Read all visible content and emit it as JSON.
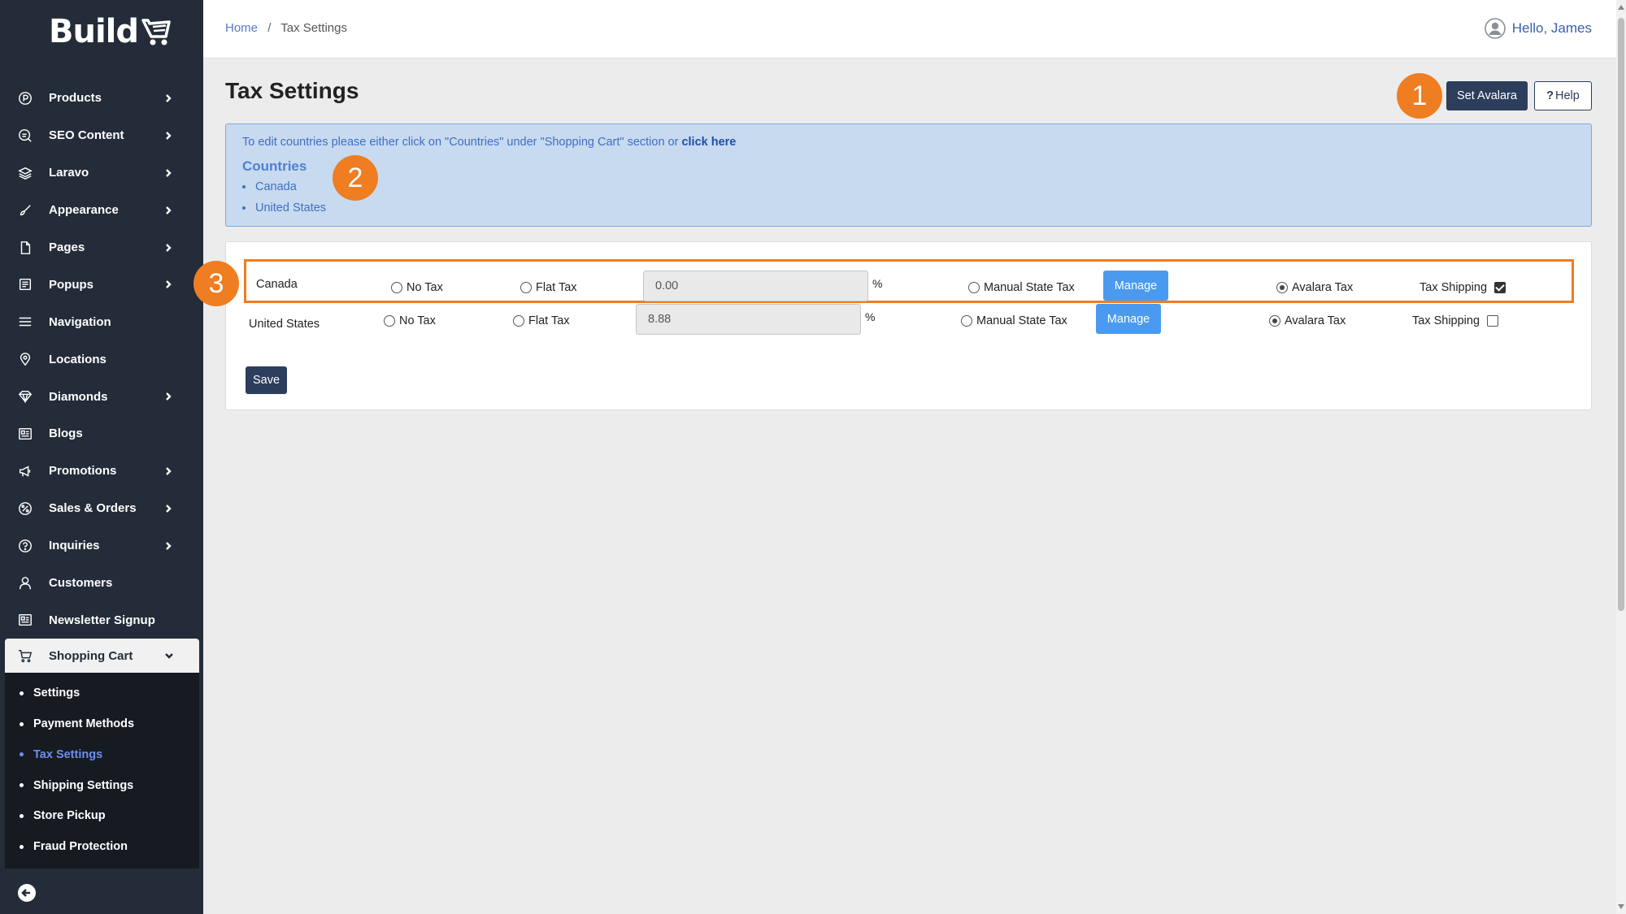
{
  "app": {
    "logo_text": "Build"
  },
  "sidebar": {
    "items": [
      {
        "label": "Products",
        "icon": "products-icon",
        "has_children": true
      },
      {
        "label": "SEO Content",
        "icon": "seo-icon",
        "has_children": true
      },
      {
        "label": "Laravo",
        "icon": "layers-icon",
        "has_children": true
      },
      {
        "label": "Appearance",
        "icon": "brush-icon",
        "has_children": true
      },
      {
        "label": "Pages",
        "icon": "file-icon",
        "has_children": true
      },
      {
        "label": "Popups",
        "icon": "popup-icon",
        "has_children": true
      },
      {
        "label": "Navigation",
        "icon": "menu-icon",
        "has_children": false
      },
      {
        "label": "Locations",
        "icon": "map-pin-icon",
        "has_children": false
      },
      {
        "label": "Diamonds",
        "icon": "diamond-icon",
        "has_children": true
      },
      {
        "label": "Blogs",
        "icon": "blog-icon",
        "has_children": false
      },
      {
        "label": "Promotions",
        "icon": "megaphone-icon",
        "has_children": true
      },
      {
        "label": "Sales & Orders",
        "icon": "percent-icon",
        "has_children": true
      },
      {
        "label": "Inquiries",
        "icon": "question-icon",
        "has_children": true
      },
      {
        "label": "Customers",
        "icon": "user-icon",
        "has_children": false
      },
      {
        "label": "Newsletter Signup",
        "icon": "newsletter-icon",
        "has_children": false
      },
      {
        "label": "Shopping Cart",
        "icon": "cart-icon",
        "has_children": true,
        "expanded": true
      }
    ],
    "sub_items": [
      {
        "label": "Settings"
      },
      {
        "label": "Payment Methods"
      },
      {
        "label": "Tax Settings",
        "current": true
      },
      {
        "label": "Shipping Settings"
      },
      {
        "label": "Store Pickup"
      },
      {
        "label": "Fraud Protection"
      }
    ]
  },
  "header": {
    "breadcrumb": {
      "home": "Home",
      "separator": "/",
      "current": "Tax Settings"
    },
    "user_greeting": "Hello, James"
  },
  "page": {
    "title": "Tax Settings",
    "set_avalara_label": "Set Avalara",
    "help_label": "Help",
    "help_prefix": "?"
  },
  "markers": {
    "m1": "1",
    "m2": "2",
    "m3": "3"
  },
  "info": {
    "message": "To edit countries please either click on \"Countries\" under \"Shopping Cart\" section or ",
    "link_text": "click here",
    "countries_title": "Countries",
    "countries": [
      "Canada",
      "United States"
    ]
  },
  "tax_rows": [
    {
      "country": "Canada",
      "no_tax": "No Tax",
      "flat_tax": "Flat Tax",
      "rate": "0.00",
      "pct": "%",
      "manual_state_tax": "Manual State Tax",
      "manage": "Manage",
      "avalara_tax": "Avalara Tax",
      "tax_shipping": "Tax Shipping",
      "selected": "avalara",
      "shipping_checked": true
    },
    {
      "country": "United States",
      "no_tax": "No Tax",
      "flat_tax": "Flat Tax",
      "rate": "8.88",
      "pct": "%",
      "manual_state_tax": "Manual State Tax",
      "manage": "Manage",
      "avalara_tax": "Avalara Tax",
      "tax_shipping": "Tax Shipping",
      "selected": "avalara",
      "shipping_checked": false
    }
  ],
  "save_label": "Save",
  "colors": {
    "sidebar_bg": "#232c38",
    "accent_marker": "#ef7d22",
    "primary_button": "#2c3e5c",
    "manage_button": "#4a9bf0",
    "info_bg": "#c8daf0"
  }
}
